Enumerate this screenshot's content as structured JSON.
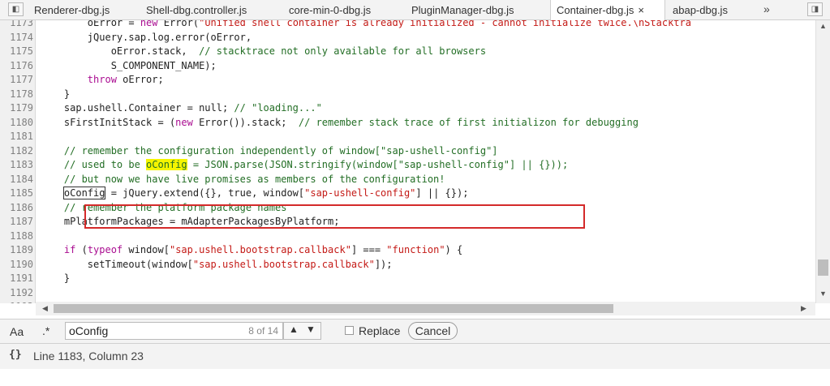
{
  "tabs": [
    {
      "label": "Renderer-dbg.js"
    },
    {
      "label": "Shell-dbg.controller.js"
    },
    {
      "label": "core-min-0-dbg.js"
    },
    {
      "label": "PluginManager-dbg.js"
    },
    {
      "label": "Container-dbg.js",
      "close": "×"
    },
    {
      "label": "abap-dbg.js"
    }
  ],
  "overflow_label": "»",
  "icons": {
    "sidebar_toggle": "sidebar-toggle-icon",
    "debugger_toggle": "debugger-toggle-icon"
  },
  "line_numbers": [
    "1173",
    "1174",
    "1175",
    "1176",
    "1177",
    "1178",
    "1179",
    "1180",
    "1181",
    "1182",
    "1183",
    "1184",
    "1185",
    "1186",
    "1187",
    "1188",
    "1189",
    "1190",
    "1191",
    "1192",
    "1193"
  ],
  "code": {
    "l1173_a": "        oError = ",
    "l1173_kw": "new",
    "l1173_b": " Error(",
    "l1173_str": "\"Unified shell container is already initialized - cannot initialize twice.\\nStacktra",
    "l1174": "        jQuery.sap.log.error(oError,",
    "l1175_a": "            oError.stack,  ",
    "l1175_cm": "// stacktrace not only available for all browsers",
    "l1176": "            S_COMPONENT_NAME);",
    "l1177_kw": "        throw",
    "l1177_b": " oError;",
    "l1178": "    }",
    "l1179_a": "    sap.ushell.Container = null; ",
    "l1179_cm": "// \"loading...\"",
    "l1180_a": "    sFirstInitStack = (",
    "l1180_kw": "new",
    "l1180_b": " Error()).stack;  ",
    "l1180_cm": "// remember stack trace of first initializon for debugging",
    "l1181": "",
    "l1182_cm": "    // remember the configuration independently of window[\"sap-ushell-config\"]",
    "l1183_cm_a": "    // used to be ",
    "l1183_hl": "oConfig",
    "l1183_cm_b": " = JSON.parse(JSON.stringify(window[\"sap-ushell-config\"] || {}));",
    "l1184_cm": "    // but now we have live promises as members of the configuration!",
    "l1185_a": "    ",
    "l1185_cur": "oConfig",
    "l1185_b": " = jQuery.extend({}, true, window[",
    "l1185_str": "\"sap-ushell-config\"",
    "l1185_c": "] || {});",
    "l1186_cm": "    // remember the platform package names",
    "l1187": "    mPlatformPackages = mAdapterPackagesByPlatform;",
    "l1188": "",
    "l1189_kw": "    if",
    "l1189_a": " (",
    "l1189_kw2": "typeof",
    "l1189_b": " window[",
    "l1189_str": "\"sap.ushell.bootstrap.callback\"",
    "l1189_c": "] === ",
    "l1189_str2": "\"function\"",
    "l1189_d": ") {",
    "l1190_a": "        setTimeout(window[",
    "l1190_str": "\"sap.ushell.bootstrap.callback\"",
    "l1190_b": "]);",
    "l1191": "    }",
    "l1192": "",
    "l1193": ""
  },
  "search": {
    "case_label": "Aa",
    "regex_label": ".*",
    "query": "oConfig",
    "count": "8 of 14",
    "prev_label": "▲",
    "next_label": "▼",
    "replace_label": "Replace",
    "cancel_label": "Cancel"
  },
  "status": {
    "format_icon": "{}",
    "position": "Line 1183, Column 23"
  }
}
